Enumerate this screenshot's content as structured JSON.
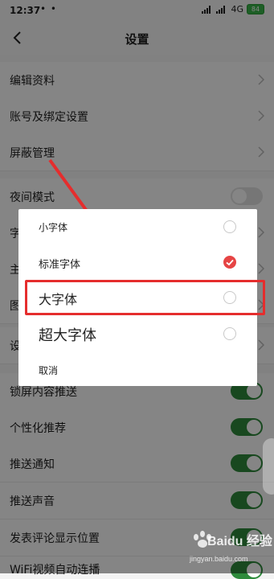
{
  "status": {
    "time": "12:37",
    "dots": "• •",
    "network": "4G",
    "battery": "84"
  },
  "header": {
    "title": "设置"
  },
  "settings": {
    "edit_profile": "编辑资料",
    "account_binding": "账号及绑定设置",
    "block_management": "屏蔽管理",
    "night_mode": "夜间模式",
    "partial_row_1": "字",
    "partial_row_2": "主",
    "partial_row_3": "图",
    "partial_row_4": "设",
    "lockscreen_push": "锁屏内容推送",
    "personalized_recommend": "个性化推荐",
    "push_notification": "推送通知",
    "push_sound": "推送声音",
    "comment_position": "发表评论显示位置",
    "wifi_autoplay": "WiFi视频自动连播"
  },
  "toggles": {
    "night_mode": false,
    "lockscreen_push": true,
    "personalized_recommend": true,
    "push_notification": true,
    "push_sound": true,
    "comment_position": true,
    "wifi_autoplay": true
  },
  "font_dialog": {
    "options": [
      {
        "label": "小字体",
        "selected": false
      },
      {
        "label": "标准字体",
        "selected": true
      },
      {
        "label": "大字体",
        "selected": false
      },
      {
        "label": "超大字体",
        "selected": false
      }
    ],
    "cancel": "取消"
  },
  "watermark": {
    "text": "Baidu 经验",
    "url": "jingyan.baidu.com"
  },
  "colors": {
    "accent_red": "#e64444",
    "toggle_green": "#2e8b3c",
    "annotation_red": "#e52d2d"
  }
}
